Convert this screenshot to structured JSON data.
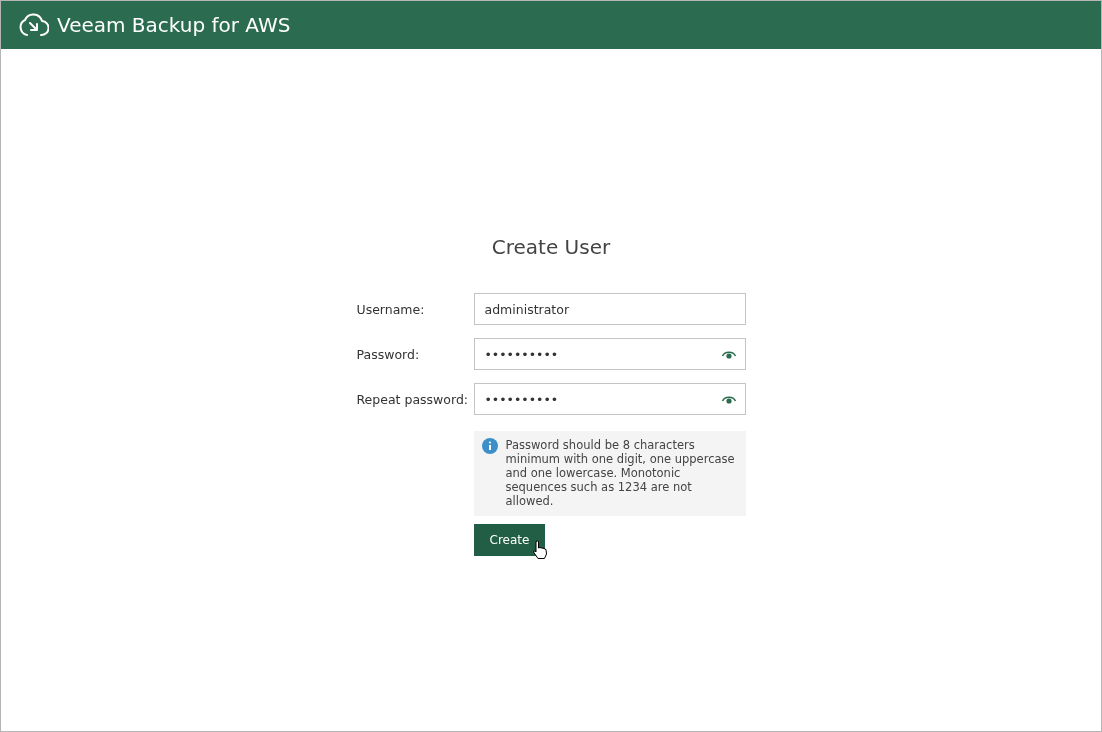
{
  "header": {
    "title": "Veeam Backup for AWS"
  },
  "form": {
    "title": "Create User",
    "fields": [
      {
        "label": "Username:",
        "kind": "text",
        "value": "administrator"
      },
      {
        "label": "Password:",
        "kind": "password",
        "value": "••••••••••"
      },
      {
        "label": "Repeat password:",
        "kind": "password",
        "value": "••••••••••"
      }
    ],
    "hint": "Password should be 8 characters minimum with one digit, one uppercase and one lowercase. Monotonic sequences such as 1234 are not allowed.",
    "button": "Create"
  }
}
